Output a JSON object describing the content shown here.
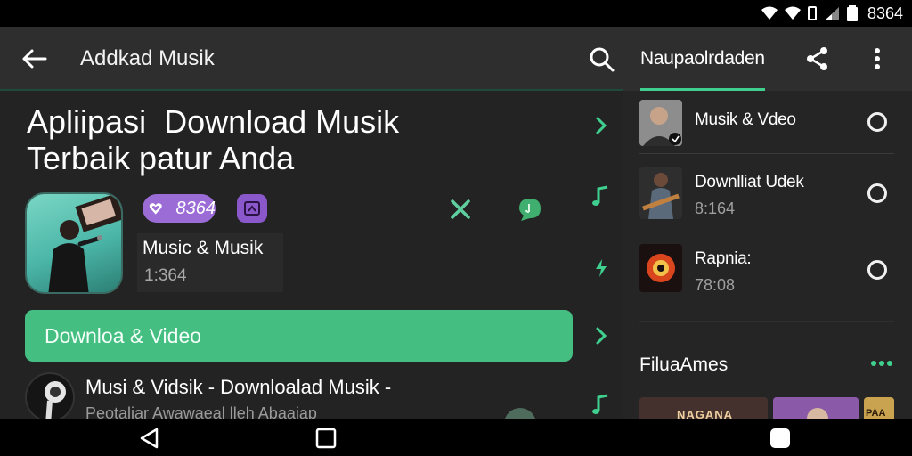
{
  "status_bar": {
    "time": "8364",
    "icons": [
      "wifi-icon",
      "wifi-icon",
      "battery-outline-icon",
      "signal-icon",
      "battery-icon"
    ]
  },
  "header": {
    "title": "Addkad Musik",
    "active_tab": "Naupaolrdaden",
    "icons": [
      "back-arrow-icon",
      "search-icon",
      "share-icon",
      "more-vert-icon"
    ]
  },
  "main": {
    "heading_line1": "Apliipasi  Download Musik",
    "heading_line2": "Terbaik patur Anda",
    "badge_count": "8364",
    "card_title": "Music & Musik",
    "card_time": "1:364",
    "download_button": "Downloa & Video",
    "row_title": "Musi & Vidsik - Downloalad Musik -",
    "row_subtitle": "Peotaliar Awawaeal lleh Abaaiap"
  },
  "panel": {
    "items": [
      {
        "title": "Musik & Vdeo",
        "subtitle": ""
      },
      {
        "title": "Downlliat Udek",
        "subtitle": "8:164"
      },
      {
        "title": "Rapnia:",
        "subtitle": "78:08"
      }
    ],
    "section_title": "FiluaAmes",
    "poster_labels": [
      "NAGANA",
      "",
      "PAA"
    ]
  },
  "colors": {
    "accent": "#45be82",
    "tab_underline": "#3fcf8e",
    "badge": "#9b6cd6",
    "background": "#232323"
  }
}
